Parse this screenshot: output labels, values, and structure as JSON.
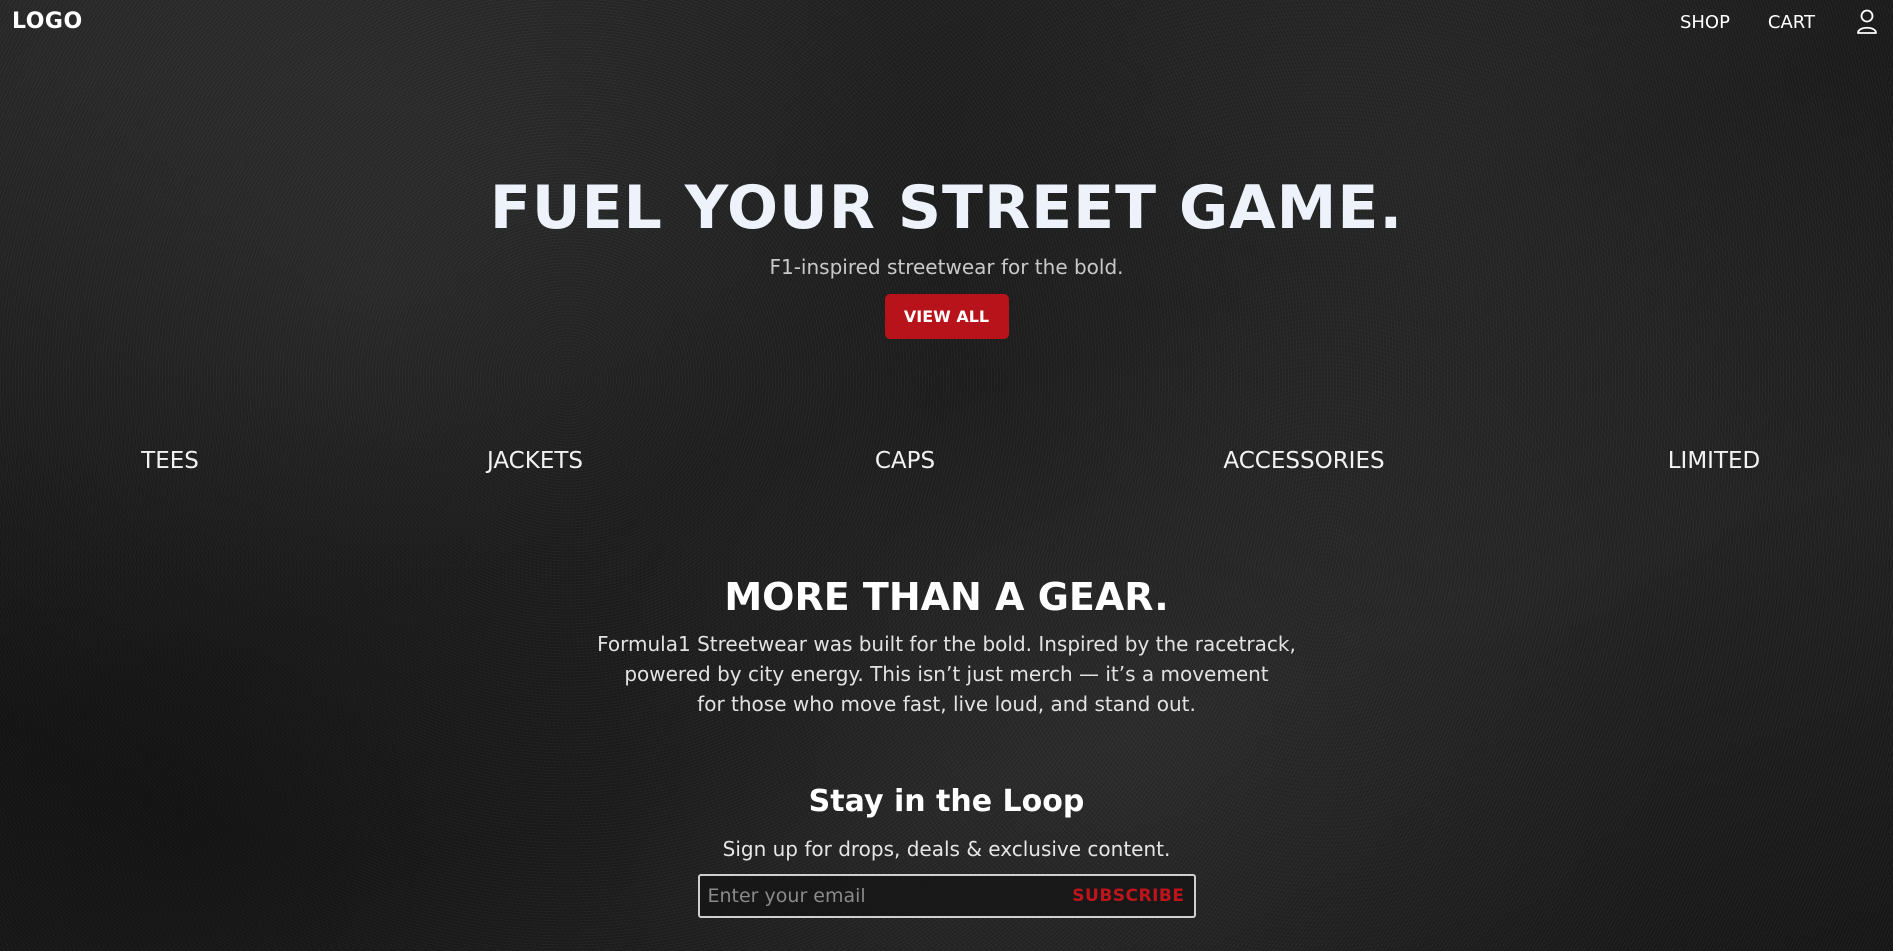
{
  "header": {
    "logo": "LOGO",
    "nav": {
      "shop": "SHOP",
      "cart": "CART"
    },
    "user_icon": "user-icon"
  },
  "hero": {
    "title": "FUEL YOUR STREET GAME.",
    "subtitle": "F1-inspired streetwear for the bold.",
    "cta": "VIEW ALL"
  },
  "categories": [
    "TEES",
    "JACKETS",
    "CAPS",
    "ACCESSORIES",
    "LIMITED"
  ],
  "about": {
    "title": "MORE THAN A GEAR.",
    "lines": [
      "Formula1 Streetwear was built for the bold. Inspired by the racetrack,",
      "powered by city energy. This isn’t just merch — it’s a movement",
      "for those who move fast, live loud, and stand out."
    ]
  },
  "newsletter": {
    "title": "Stay in the Loop",
    "subtitle": "Sign up for drops, deals & exclusive content.",
    "email_value": "",
    "email_placeholder": "Enter your email",
    "button": "SUBSCRIBE"
  },
  "colors": {
    "accent": "#b8131a",
    "subscribe_text": "#c0141c",
    "background": "#1f1f1f"
  }
}
